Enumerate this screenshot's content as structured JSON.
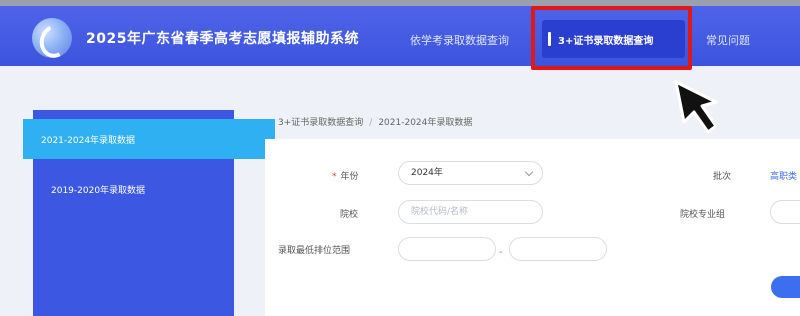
{
  "header": {
    "title": "2025年广东省春季高考志愿填报辅助系统",
    "nav": [
      {
        "label": "依学考录取数据查询"
      },
      {
        "label": "3+证书录取数据查询",
        "active": true
      },
      {
        "label": "常见问题"
      }
    ]
  },
  "sidebar": {
    "items": [
      {
        "label": "2021-2024年录取数据",
        "active": true
      },
      {
        "label": "2019-2020年录取数据"
      }
    ]
  },
  "breadcrumb": {
    "parent": "3+证书录取数据查询",
    "separator": "/",
    "current": "2021-2024年录取数据"
  },
  "form": {
    "year": {
      "required_mark": "*",
      "label": "年份",
      "value": "2024年"
    },
    "batch": {
      "label": "批次",
      "value": "高职类"
    },
    "school": {
      "label": "院校",
      "placeholder": "院校代码/名称"
    },
    "major_group": {
      "label": "院校专业组"
    },
    "rank_range": {
      "label": "录取最低排位范围",
      "separator": "-"
    }
  },
  "colors": {
    "header_bg": "#4f63e8",
    "sidebar_bg": "#3c57e2",
    "sidebar_active": "#2fb0f2",
    "highlight": "#e01818",
    "link": "#3c6ef0"
  }
}
